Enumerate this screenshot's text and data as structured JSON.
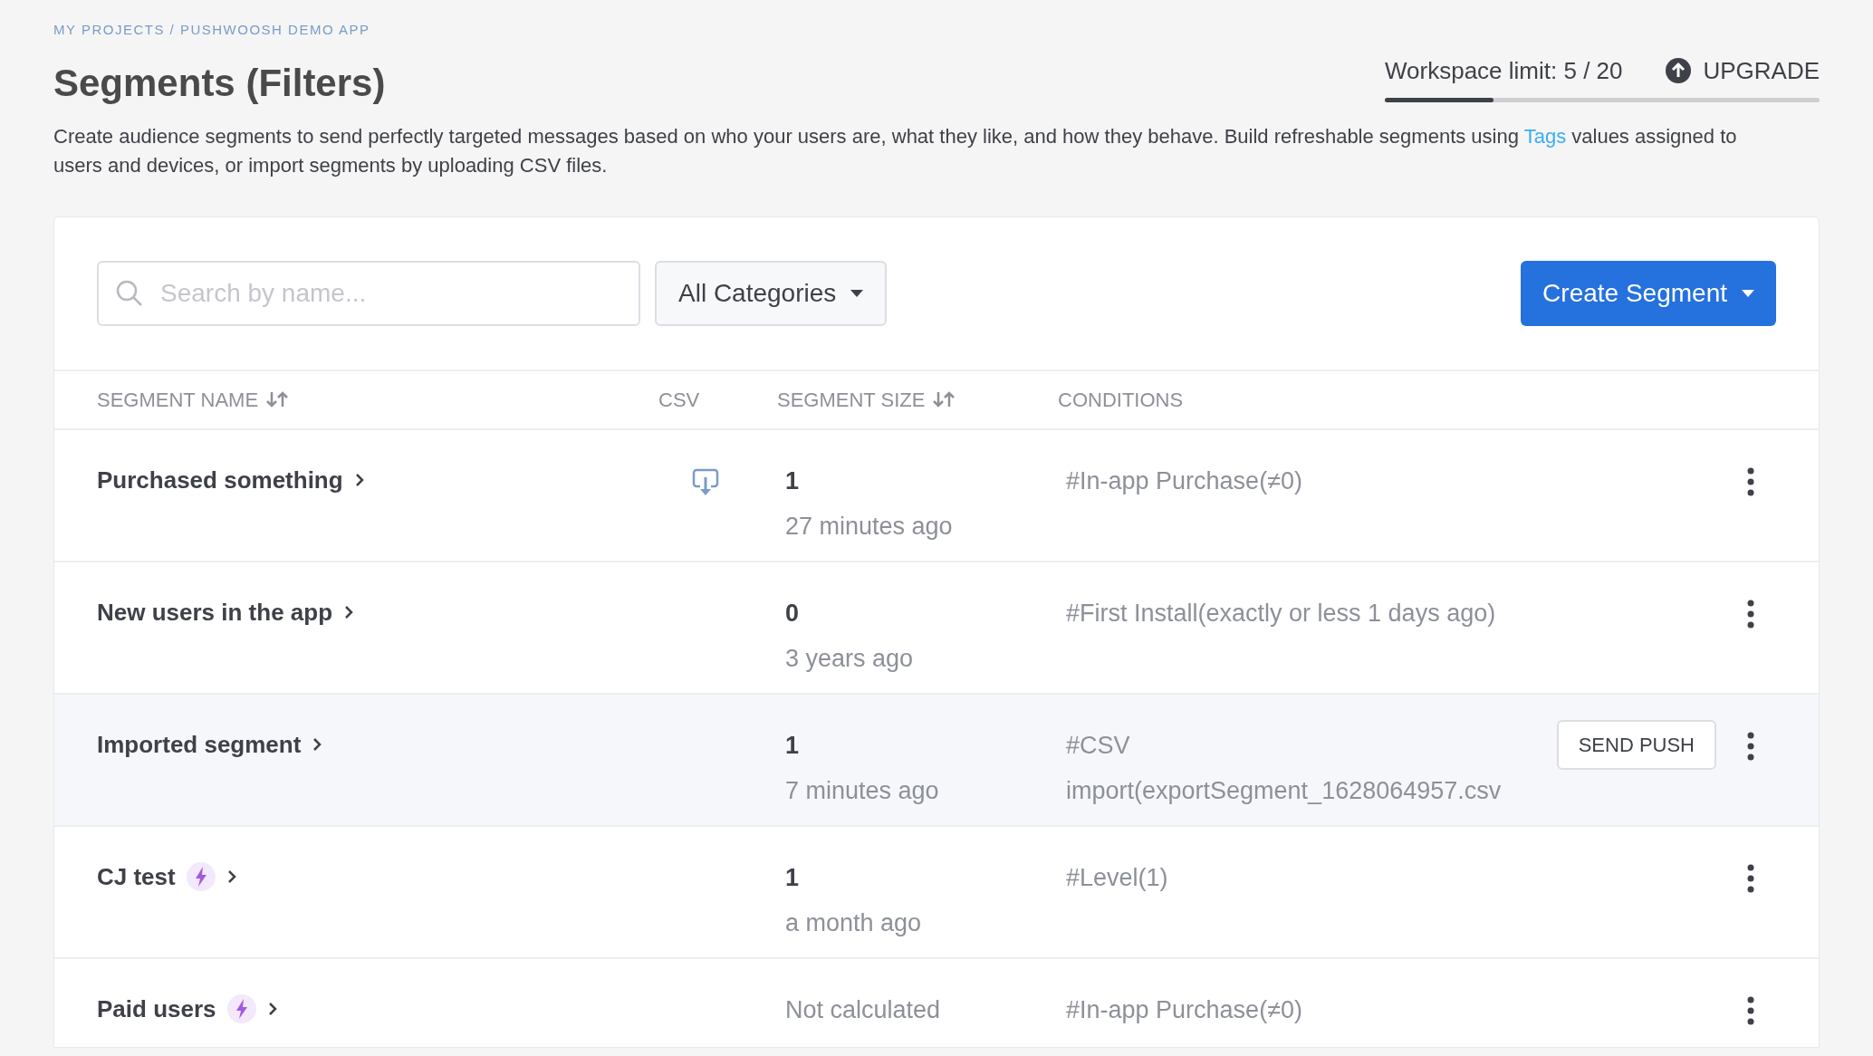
{
  "breadcrumb": "MY PROJECTS / PUSHWOOSH DEMO APP",
  "title": "Segments (Filters)",
  "workspace_limit": {
    "label": "Workspace limit: 5 / 20",
    "level": 0.25,
    "action": "UPGRADE"
  },
  "description": "Create audience segments to send perfectly targeted messages based on who your users are, what they like, and how they behave. Build refreshable segments using ",
  "description_link": "Tags",
  "description_end": " values assigned to users and devices, or import segments by uploading CSV files.",
  "search": {
    "placeholder": "Search by name..."
  },
  "category_filter": "All Categories",
  "create_button": "Create Segment",
  "columns": [
    {
      "label": "SEGMENT NAME",
      "sortable": true
    },
    {
      "label": "CSV",
      "sortable": false
    },
    {
      "label": "SEGMENT SIZE",
      "sortable": true
    },
    {
      "label": "CONDITIONS",
      "sortable": false
    }
  ],
  "rows": [
    {
      "name": "Purchased something",
      "realtime": false,
      "csv": true,
      "size": "1",
      "calculated": true,
      "updated": "27 minutes ago",
      "conditions": [
        "#In-app Purchase(≠0)"
      ],
      "highlighted": false
    },
    {
      "name": "New users in the app",
      "realtime": false,
      "csv": false,
      "size": "0",
      "calculated": true,
      "updated": "3 years ago",
      "conditions": [
        "#First Install(exactly or less 1 days ago)"
      ],
      "highlighted": false
    },
    {
      "name": "Imported segment",
      "realtime": false,
      "csv": false,
      "size": "1",
      "calculated": true,
      "updated": "7 minutes ago",
      "conditions": [
        "#CSV",
        "import(exportSegment_1628064957.csv"
      ],
      "highlighted": true,
      "action": "SEND PUSH"
    },
    {
      "name": "CJ test",
      "realtime": true,
      "csv": false,
      "size": "1",
      "calculated": true,
      "updated": "a month ago",
      "conditions": [
        "#Level(1)"
      ],
      "highlighted": false
    },
    {
      "name": "Paid users",
      "realtime": true,
      "csv": false,
      "size": "Not calculated",
      "calculated": false,
      "conditions": [
        "#In-app Purchase(≠0)"
      ],
      "highlighted": false
    }
  ]
}
